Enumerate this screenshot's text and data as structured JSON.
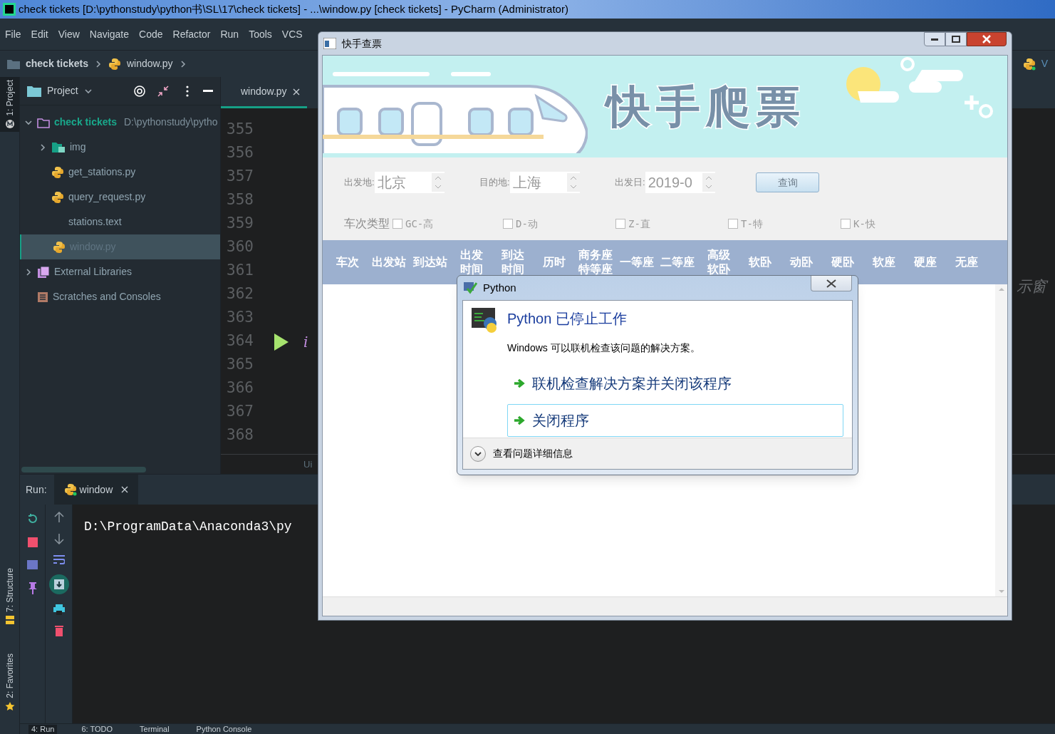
{
  "window": {
    "title": "check tickets [D:\\pythonstudy\\python书\\SL\\17\\check tickets] - ...\\window.py [check tickets] - PyCharm (Administrator)"
  },
  "menu": [
    "File",
    "Edit",
    "View",
    "Navigate",
    "Code",
    "Refactor",
    "Run",
    "Tools",
    "VCS"
  ],
  "breadcrumb": [
    "check tickets",
    "window.py"
  ],
  "side_tabs_top": [
    "1: Project"
  ],
  "side_tabs_bottom": [
    "7: Structure",
    "2: Favorites"
  ],
  "project_panel": {
    "title": "Project",
    "tree": [
      {
        "name": "check tickets",
        "path": "D:\\pythonstudy\\pytho",
        "kind": "root",
        "expanded": true,
        "selected": false,
        "children": [
          {
            "name": "img",
            "kind": "image-folder",
            "expanded": false,
            "selected": false
          },
          {
            "name": "get_stations.py",
            "kind": "python",
            "selected": false
          },
          {
            "name": "query_request.py",
            "kind": "python",
            "selected": false
          },
          {
            "name": "stations.text",
            "kind": "text",
            "selected": false
          },
          {
            "name": "window.py",
            "kind": "python",
            "selected": true
          }
        ]
      },
      {
        "name": "External Libraries",
        "kind": "library",
        "expanded": false,
        "selected": false
      },
      {
        "name": "Scratches and Consoles",
        "kind": "scratch",
        "selected": false
      }
    ]
  },
  "editor": {
    "tab": "window.py",
    "line_numbers": [
      "355",
      "356",
      "357",
      "358",
      "359",
      "360",
      "361",
      "362",
      "363",
      "364",
      "365",
      "366",
      "367",
      "368"
    ],
    "code_fragment": "i",
    "status_text": "Ui",
    "right_text": "V",
    "hint_text": "示窗"
  },
  "run_panel": {
    "label": "Run:",
    "tab": "window",
    "output": "D:\\ProgramData\\Anaconda3\\py"
  },
  "bottom_tabs": [
    {
      "label": "4: Run",
      "selected": true
    },
    {
      "label": "6: TODO",
      "selected": false
    },
    {
      "label": "Terminal",
      "selected": false
    },
    {
      "label": "Python Console",
      "selected": false
    }
  ],
  "app_window": {
    "title": "快手查票",
    "banner_title": "快手爬票",
    "fields": [
      {
        "label": "出发地:",
        "value": "北京"
      },
      {
        "label": "目的地:",
        "value": "上海"
      },
      {
        "label": "出发日:",
        "value": "2019-0"
      }
    ],
    "query_button": "查询",
    "train_type_label": "车次类型",
    "train_types": [
      {
        "label": "GC-高",
        "checked": false
      },
      {
        "label": "D-动",
        "checked": false
      },
      {
        "label": "Z-直",
        "checked": false
      },
      {
        "label": "T-特",
        "checked": false
      },
      {
        "label": "K-快",
        "checked": false
      }
    ],
    "columns": [
      "车次",
      "出发站",
      "到达站",
      "出发时间",
      "到达时间",
      "历时",
      "商务座特等座",
      "一等座",
      "二等座",
      "高级软卧",
      "软卧",
      "动卧",
      "硬卧",
      "软座",
      "硬座",
      "无座"
    ]
  },
  "dialog": {
    "title": "Python",
    "heading": "Python 已停止工作",
    "message": "Windows 可以联机检查该问题的解决方案。",
    "options": [
      {
        "label": "联机检查解决方案并关闭该程序",
        "selected": false
      },
      {
        "label": "关闭程序",
        "selected": true
      }
    ],
    "details": "查看问题详细信息"
  }
}
